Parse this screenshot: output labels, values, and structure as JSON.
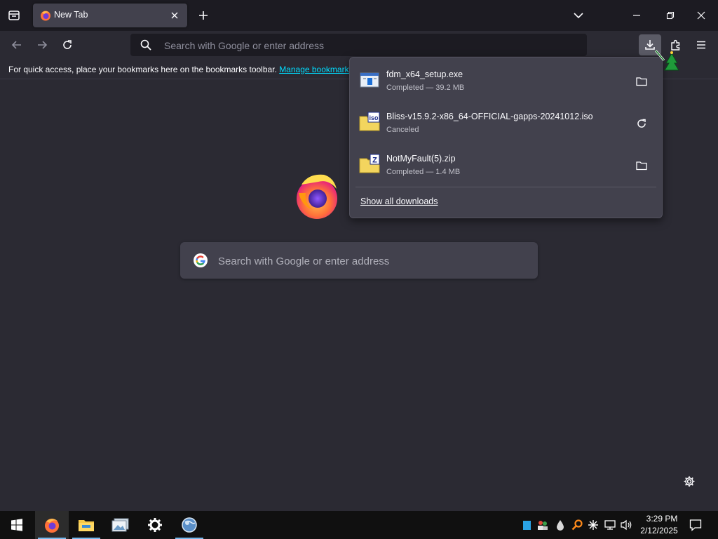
{
  "tab": {
    "title": "New Tab"
  },
  "urlbar": {
    "placeholder": "Search with Google or enter address"
  },
  "bookmarks_bar": {
    "message": "For quick access, place your bookmarks here on the bookmarks toolbar. ",
    "manage_link": "Manage bookmarks"
  },
  "content": {
    "search_placeholder": "Search with Google or enter address"
  },
  "downloads": {
    "items": [
      {
        "name": "fdm_x64_setup.exe",
        "status": "Completed — 39.2 MB",
        "file_icon": "exe-file-icon",
        "action_icon": "folder-icon"
      },
      {
        "name": "Bliss-v15.9.2-x86_64-OFFICIAL-gapps-20241012.iso",
        "status": "Canceled",
        "file_icon": "iso-file-icon",
        "action_icon": "retry-icon"
      },
      {
        "name": "NotMyFault(5).zip",
        "status": "Completed — 1.4 MB",
        "file_icon": "zip-file-icon",
        "action_icon": "folder-icon"
      }
    ],
    "show_all": "Show all downloads"
  },
  "taskbar": {
    "apps": [
      "start-icon",
      "firefox-icon",
      "file-explorer-icon",
      "image-viewer-icon",
      "settings-icon",
      "globe-icon"
    ],
    "clock_time": "3:29 PM",
    "clock_date": "2/12/2025"
  },
  "colors": {
    "tabstrip": "#1c1b22",
    "toolbar": "#2b2a33",
    "panel": "#42414d",
    "link": "#00ddff",
    "taskbar": "#101010"
  }
}
